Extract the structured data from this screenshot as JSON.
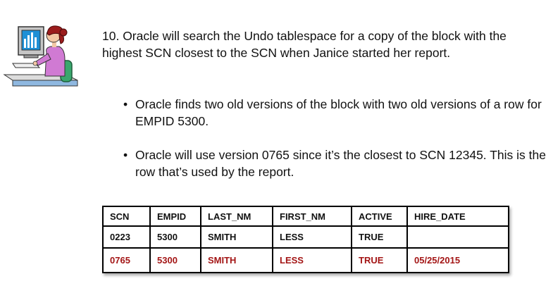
{
  "clipart": {
    "icon": "person-at-computer-icon"
  },
  "heading": "10. Oracle will search the Undo tablespace for a copy of the block with the highest SCN closest to the SCN when Janice started her report.",
  "bullets": [
    "Oracle finds two old versions of the block with two old versions of a row for EMPID 5300.",
    "Oracle will use version 0765 since it’s the closest to SCN 12345. This is the row that’s used by the report."
  ],
  "table": {
    "headers": [
      "SCN",
      "EMPID",
      "LAST_NM",
      "FIRST_NM",
      "ACTIVE",
      "HIRE_DATE"
    ],
    "rows": [
      [
        "0223",
        "5300",
        "SMITH",
        "LESS",
        "TRUE",
        ""
      ],
      [
        "0765",
        "5300",
        "SMITH",
        "LESS",
        "TRUE",
        "05/25/2015"
      ]
    ],
    "highlight_color": "#a31515"
  }
}
